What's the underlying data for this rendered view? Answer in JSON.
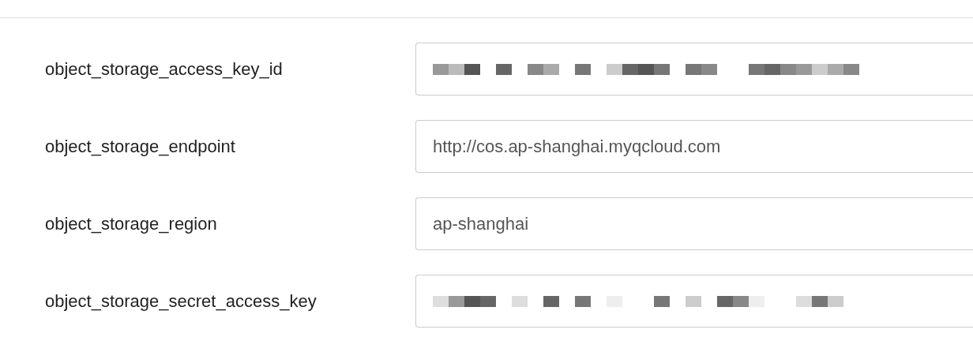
{
  "fields": [
    {
      "label": "object_storage_access_key_id",
      "kind": "redacted"
    },
    {
      "label": "object_storage_endpoint",
      "kind": "text",
      "value": "http://cos.ap-shanghai.myqcloud.com"
    },
    {
      "label": "object_storage_region",
      "kind": "text",
      "value": "ap-shanghai"
    },
    {
      "label": "object_storage_secret_access_key",
      "kind": "redacted"
    }
  ]
}
